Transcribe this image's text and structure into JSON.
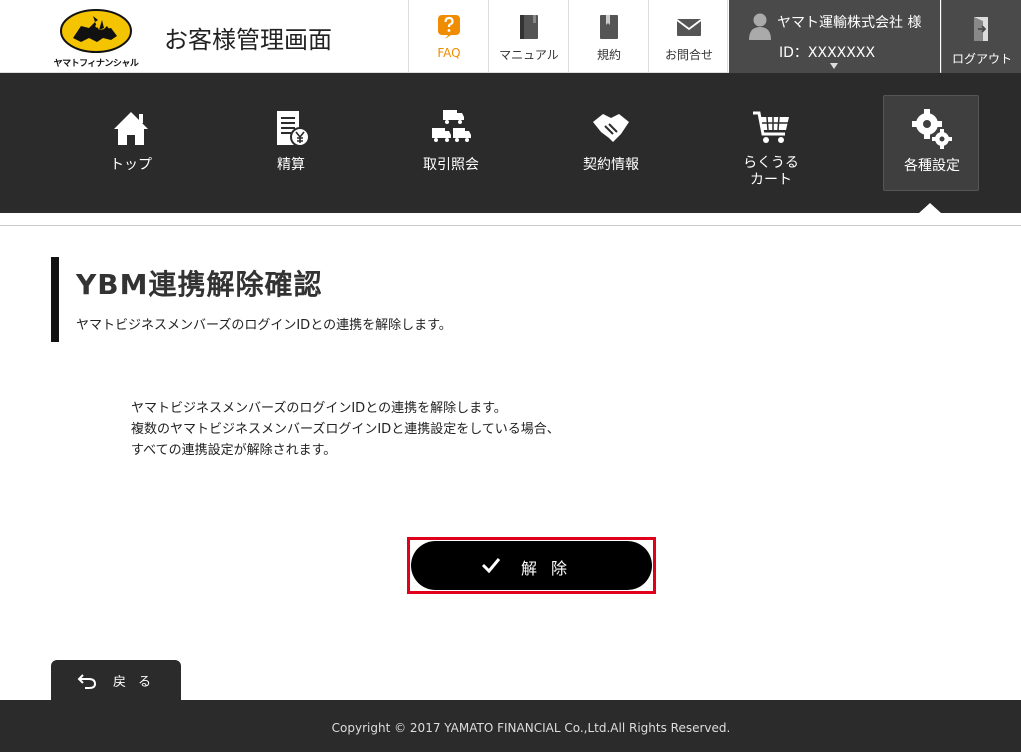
{
  "header": {
    "logo_text": "ヤマトフィナンシャル",
    "app_title": "お客様管理画面",
    "buttons": [
      {
        "label": "FAQ",
        "icon": "question-icon"
      },
      {
        "label": "マニュアル",
        "icon": "book-icon"
      },
      {
        "label": "規約",
        "icon": "document-icon"
      },
      {
        "label": "お問合せ",
        "icon": "mail-icon"
      }
    ],
    "user": {
      "name": "ヤマト運輸株式会社 様",
      "id": "ID：XXXXXXX",
      "icon": "person-icon"
    },
    "logout_label": "ログアウト"
  },
  "nav": {
    "items": [
      {
        "label": "トップ",
        "icon": "home-icon"
      },
      {
        "label": "精算",
        "icon": "invoice-yen-icon"
      },
      {
        "label": "取引照会",
        "icon": "trucks-icon"
      },
      {
        "label": "契約情報",
        "icon": "handshake-icon"
      },
      {
        "label_line1": "らくうる",
        "label_line2": "カート",
        "icon": "cart-icon"
      },
      {
        "label": "各種設定",
        "icon": "gears-icon",
        "active": true
      }
    ]
  },
  "page": {
    "title": "YBM連携解除確認",
    "subtitle": "ヤマトビジネスメンバーズのログインIDとの連携を解除します。",
    "description": [
      "ヤマトビジネスメンバーズのログインIDとの連携を解除します。",
      "複数のヤマトビジネスメンバーズログインIDと連携設定をしている場合、",
      "すべての連携設定が解除されます。"
    ],
    "submit_label": "解除",
    "back_label": "戻る"
  },
  "footer": {
    "copyright": "Copyright © 2017 YAMATO FINANCIAL Co.,Ltd.All Rights Reserved."
  },
  "colors": {
    "accent_orange": "#f08c00",
    "nav_bg": "#2b2b2b",
    "highlight_red": "#e0001b",
    "logo_yellow": "#f5c400"
  }
}
